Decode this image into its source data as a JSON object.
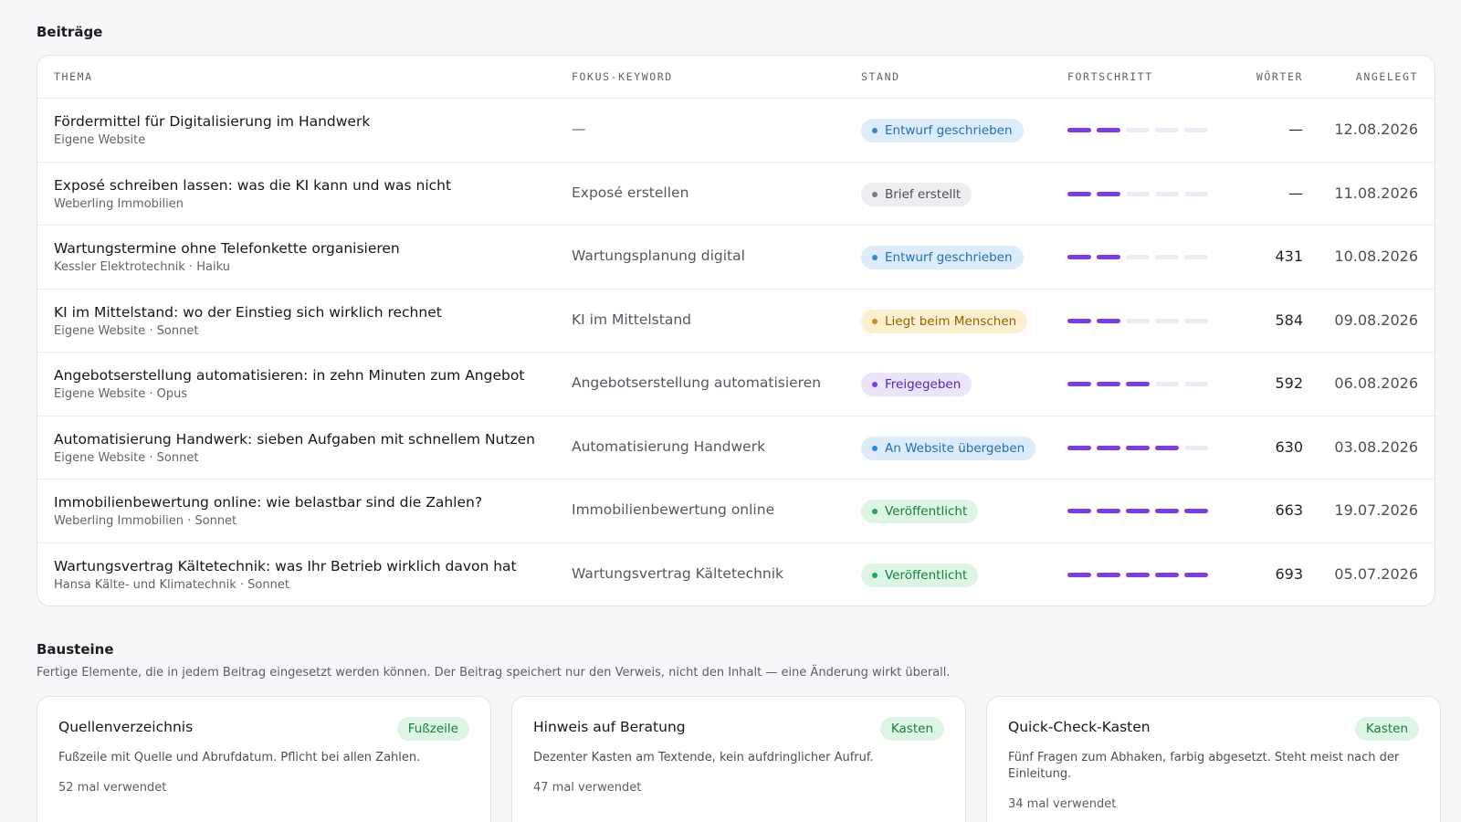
{
  "posts": {
    "section_title": "Beiträge",
    "columns": {
      "thema": "THEMA",
      "keyword": "FOKUS-KEYWORD",
      "stand": "STAND",
      "fortschritt": "FORTSCHRITT",
      "woerter": "WÖRTER",
      "angelegt": "ANGELEGT"
    },
    "rows": [
      {
        "title": "Fördermittel für Digitalisierung im Handwerk",
        "sub": "Eigene Website",
        "keyword": "—",
        "status": "Entwurf geschrieben",
        "status_kind": "blue",
        "progress": 2,
        "progress_total": 5,
        "words": "—",
        "date": "12.08.2026"
      },
      {
        "title": "Exposé schreiben lassen: was die KI kann und was nicht",
        "sub": "Weberling Immobilien",
        "keyword": "Exposé erstellen",
        "status": "Brief erstellt",
        "status_kind": "gray",
        "progress": 2,
        "progress_total": 5,
        "words": "—",
        "date": "11.08.2026"
      },
      {
        "title": "Wartungstermine ohne Telefonkette organisieren",
        "sub": "Kessler Elektrotechnik · Haiku",
        "keyword": "Wartungsplanung digital",
        "status": "Entwurf geschrieben",
        "status_kind": "blue",
        "progress": 2,
        "progress_total": 5,
        "words": "431",
        "date": "10.08.2026"
      },
      {
        "title": "KI im Mittelstand: wo der Einstieg sich wirklich rechnet",
        "sub": "Eigene Website · Sonnet",
        "keyword": "KI im Mittelstand",
        "status": "Liegt beim Menschen",
        "status_kind": "amber",
        "progress": 2,
        "progress_total": 5,
        "words": "584",
        "date": "09.08.2026"
      },
      {
        "title": "Angebotserstellung automatisieren: in zehn Minuten zum Angebot",
        "sub": "Eigene Website · Opus",
        "keyword": "Angebotserstellung automatisieren",
        "status": "Freigegeben",
        "status_kind": "purple",
        "progress": 3,
        "progress_total": 5,
        "words": "592",
        "date": "06.08.2026"
      },
      {
        "title": "Automatisierung Handwerk: sieben Aufgaben mit schnellem Nutzen",
        "sub": "Eigene Website · Sonnet",
        "keyword": "Automatisierung Handwerk",
        "status": "An Website übergeben",
        "status_kind": "blue",
        "progress": 4,
        "progress_total": 5,
        "words": "630",
        "date": "03.08.2026"
      },
      {
        "title": "Immobilienbewertung online: wie belastbar sind die Zahlen?",
        "sub": "Weberling Immobilien · Sonnet",
        "keyword": "Immobilienbewertung online",
        "status": "Veröffentlicht",
        "status_kind": "green",
        "progress": 5,
        "progress_total": 5,
        "words": "663",
        "date": "19.07.2026"
      },
      {
        "title": "Wartungsvertrag Kältetechnik: was Ihr Betrieb wirklich davon hat",
        "sub": "Hansa Kälte- und Klimatechnik · Sonnet",
        "keyword": "Wartungsvertrag Kältetechnik",
        "status": "Veröffentlicht",
        "status_kind": "green",
        "progress": 5,
        "progress_total": 5,
        "words": "693",
        "date": "05.07.2026"
      }
    ]
  },
  "status_colors": {
    "blue": {
      "bg": "#dcecfb",
      "fg": "#1d6fb8",
      "dot": "#2f86d6"
    },
    "gray": {
      "bg": "#eeeef2",
      "fg": "#4e4e5a",
      "dot": "#7a7a86"
    },
    "amber": {
      "bg": "#fdf0cf",
      "fg": "#92600a",
      "dot": "#d08a10"
    },
    "purple": {
      "bg": "#ece4fb",
      "fg": "#5b21b6",
      "dot": "#7c3aed"
    },
    "green": {
      "bg": "#dcf5e5",
      "fg": "#15803d",
      "dot": "#22a55a"
    }
  },
  "accent": "#7c3aed",
  "blocks": {
    "section_title": "Bausteine",
    "description": "Fertige Elemente, die in jedem Beitrag eingesetzt werden können. Der Beitrag speichert nur den Verweis, nicht den Inhalt — eine Änderung wirkt überall.",
    "cards": [
      {
        "name": "Quellenverzeichnis",
        "tag": "Fußzeile",
        "desc": "Fußzeile mit Quelle und Abrufdatum. Pflicht bei allen Zahlen.",
        "usage": "52 mal verwendet"
      },
      {
        "name": "Hinweis auf Beratung",
        "tag": "Kasten",
        "desc": "Dezenter Kasten am Textende, kein aufdringlicher Aufruf.",
        "usage": "47 mal verwendet"
      },
      {
        "name": "Quick-Check-Kasten",
        "tag": "Kasten",
        "desc": "Fünf Fragen zum Abhaken, farbig abgesetzt. Steht meist nach der Einleitung.",
        "usage": "34 mal verwendet"
      }
    ]
  }
}
